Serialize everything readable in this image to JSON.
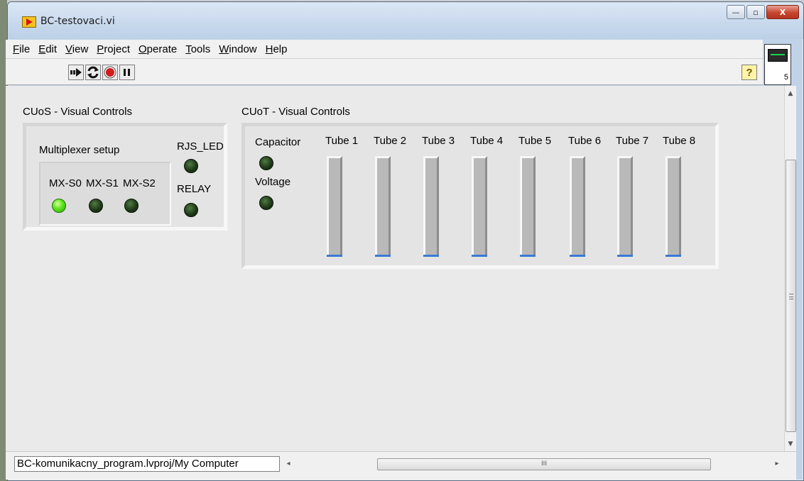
{
  "window": {
    "title": "BC-testovaci.vi",
    "controls": [
      "—",
      "▫",
      "X"
    ]
  },
  "menubar": [
    "File",
    "Edit",
    "View",
    "Project",
    "Operate",
    "Tools",
    "Window",
    "Help"
  ],
  "toolbar": {
    "buttons": [
      "run-continuously-icon",
      "run-icon",
      "abort-icon",
      "pause-icon"
    ],
    "help_label": "?"
  },
  "vi_icon": {
    "number": "5"
  },
  "cuos": {
    "title": "CUoS - Visual Controls",
    "multiplexer_label": "Multiplexer setup",
    "mx_labels": [
      "MX-S0",
      "MX-S1",
      "MX-S2"
    ],
    "mx_states": [
      true,
      false,
      false
    ],
    "rjs_led_label": "RJS_LED",
    "relay_label": "RELAY"
  },
  "cuot": {
    "title": "CUoT - Visual Controls",
    "capacitor_label": "Capacitor",
    "voltage_label": "Voltage",
    "tube_labels": [
      "Tube 1",
      "Tube 2",
      "Tube 3",
      "Tube 4",
      "Tube  5",
      "Tube 6",
      "Tube 7",
      "Tube 8"
    ],
    "tube_levels": [
      0,
      0,
      0,
      0,
      0,
      0,
      0,
      0
    ]
  },
  "status": {
    "path": "BC-komunikacny_program.lvproj/My Computer",
    "hscroll_grip": "III"
  },
  "colors": {
    "led_on": "#5ae51c",
    "led_off": "#1f3a18",
    "tube_fill": "#3a7bd5"
  }
}
